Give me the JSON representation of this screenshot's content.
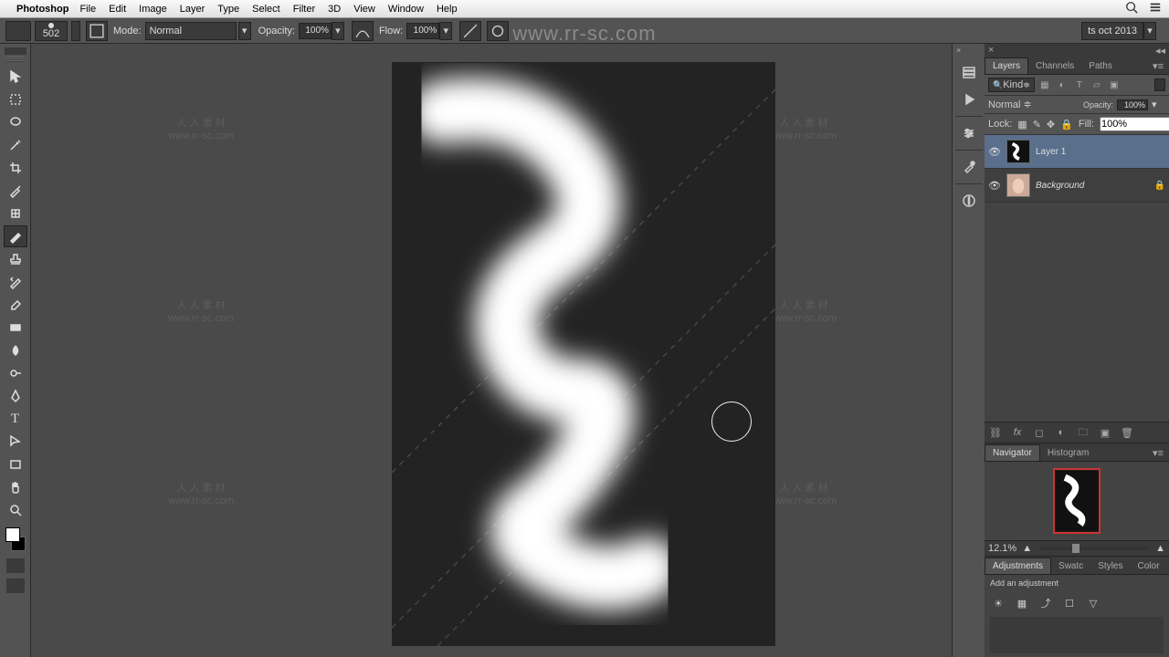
{
  "menubar": {
    "app": "Photoshop",
    "items": [
      "File",
      "Edit",
      "Image",
      "Layer",
      "Type",
      "Select",
      "Filter",
      "3D",
      "View",
      "Window",
      "Help"
    ]
  },
  "options": {
    "brush_size": "502",
    "mode_label": "Mode:",
    "mode_value": "Normal",
    "opacity_label": "Opacity:",
    "opacity_value": "100%",
    "flow_label": "Flow:",
    "flow_value": "100%",
    "workspace": "ts oct 2013"
  },
  "watermark_url": "www.rr-sc.com",
  "watermark_small_top": "人 人 素 材",
  "watermark_small_bottom": "www.rr-sc.com",
  "layers_panel": {
    "tabs": [
      "Layers",
      "Channels",
      "Paths"
    ],
    "kind_label": "Kind",
    "blend_mode": "Normal",
    "opacity_label": "Opacity:",
    "opacity_value": "100%",
    "lock_label": "Lock:",
    "fill_label": "Fill:",
    "fill_value": "100%",
    "layers": [
      {
        "name": "Layer 1",
        "selected": true,
        "locked": false,
        "italic": false
      },
      {
        "name": "Background",
        "selected": false,
        "locked": true,
        "italic": true
      }
    ]
  },
  "navigator": {
    "tabs": [
      "Navigator",
      "Histogram"
    ],
    "zoom": "12.1%"
  },
  "adjustments": {
    "tabs": [
      "Adjustments",
      "Swatc",
      "Styles",
      "Color"
    ],
    "hint": "Add an adjustment"
  }
}
